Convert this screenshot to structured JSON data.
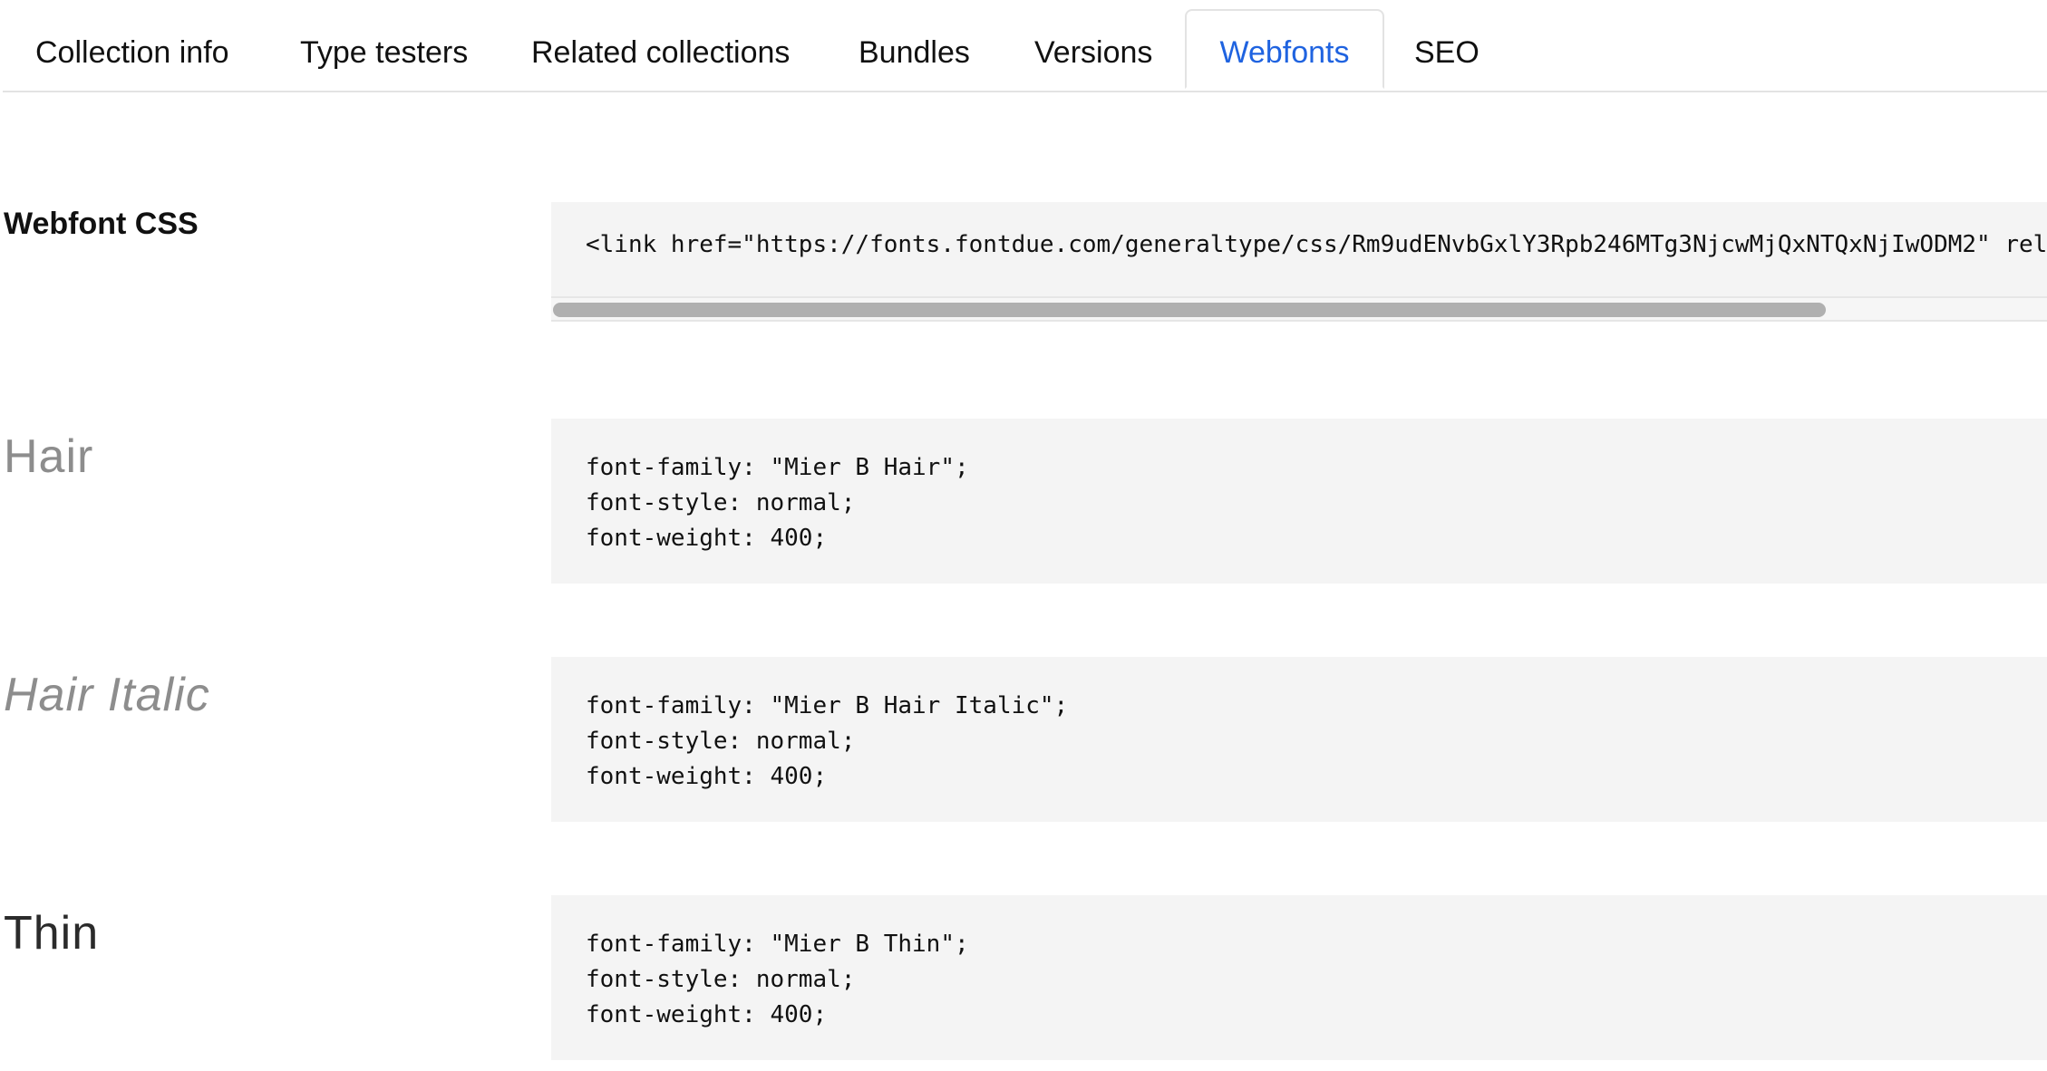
{
  "tabs": [
    {
      "label": "Collection info",
      "active": false
    },
    {
      "label": "Type testers",
      "active": false
    },
    {
      "label": "Related collections",
      "active": false
    },
    {
      "label": "Bundles",
      "active": false
    },
    {
      "label": "Versions",
      "active": false
    },
    {
      "label": "Webfonts",
      "active": true
    },
    {
      "label": "SEO",
      "active": false
    }
  ],
  "webfont_css": {
    "label": "Webfont CSS",
    "code": "<link href=\"https://fonts.fontdue.com/generaltype/css/Rm9udENvbGxlY3Rpb246MTg3NjcwMjQxNTQxNjIwODM2\" rel"
  },
  "styles": [
    {
      "name": "Hair",
      "lines": [
        "font-family: \"Mier B Hair\";",
        "font-style: normal;",
        "font-weight: 400;"
      ]
    },
    {
      "name": "Hair Italic",
      "lines": [
        "font-family: \"Mier B Hair Italic\";",
        "font-style: normal;",
        "font-weight: 400;"
      ]
    },
    {
      "name": "Thin",
      "lines": [
        "font-family: \"Mier B Thin\";",
        "font-style: normal;",
        "font-weight: 400;"
      ]
    }
  ],
  "colors": {
    "accent": "#1f63e0",
    "code_background": "#f4f4f4",
    "scrollbar_thumb": "#b0b0b0"
  }
}
